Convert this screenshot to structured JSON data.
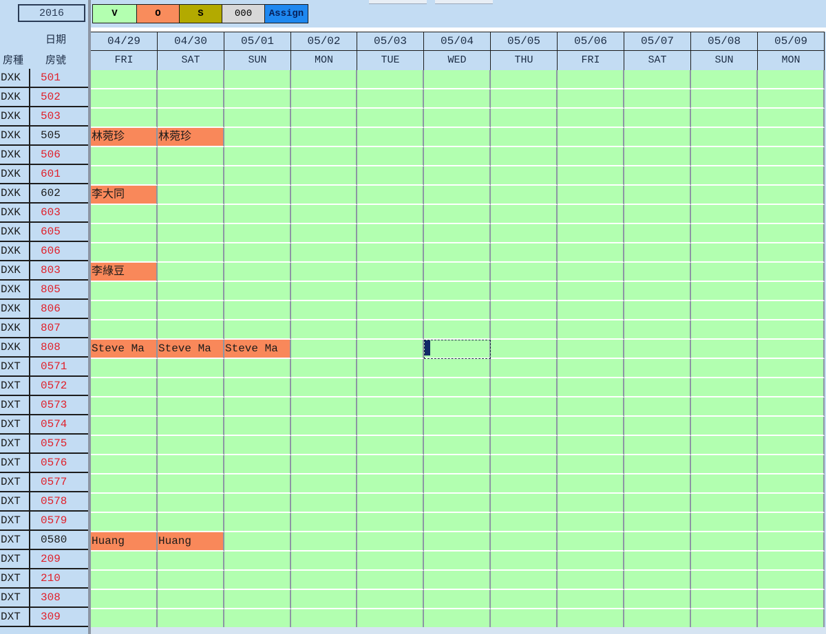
{
  "year": "2016",
  "header": {
    "date_label": "日期",
    "type_label": "房種",
    "room_label": "房號"
  },
  "legend": [
    {
      "key": "v",
      "label": "V",
      "color": "#b3ffb0"
    },
    {
      "key": "o",
      "label": "O",
      "color": "#f98c5c"
    },
    {
      "key": "s",
      "label": "S",
      "color": "#b3aa00"
    },
    {
      "key": "000",
      "label": "000",
      "color": "#d8d8d8"
    },
    {
      "key": "assign",
      "label": "Assign",
      "color": "#1e88f0"
    }
  ],
  "days": [
    {
      "date": "04/29",
      "dow": "FRI"
    },
    {
      "date": "04/30",
      "dow": "SAT"
    },
    {
      "date": "05/01",
      "dow": "SUN"
    },
    {
      "date": "05/02",
      "dow": "MON"
    },
    {
      "date": "05/03",
      "dow": "TUE"
    },
    {
      "date": "05/04",
      "dow": "WED"
    },
    {
      "date": "05/05",
      "dow": "THU"
    },
    {
      "date": "05/06",
      "dow": "FRI"
    },
    {
      "date": "05/07",
      "dow": "SAT"
    },
    {
      "date": "05/08",
      "dow": "SUN"
    },
    {
      "date": "05/09",
      "dow": "MON"
    }
  ],
  "rooms": [
    {
      "type": "DXK",
      "room": "501",
      "status": "red",
      "bookings": []
    },
    {
      "type": "DXK",
      "room": "502",
      "status": "red",
      "bookings": []
    },
    {
      "type": "DXK",
      "room": "503",
      "status": "red",
      "bookings": []
    },
    {
      "type": "DXK",
      "room": "505",
      "status": "black",
      "bookings": [
        {
          "day": 0,
          "name": "林菀珍"
        },
        {
          "day": 1,
          "name": "林菀珍"
        }
      ]
    },
    {
      "type": "DXK",
      "room": "506",
      "status": "red",
      "bookings": []
    },
    {
      "type": "DXK",
      "room": "601",
      "status": "red",
      "bookings": []
    },
    {
      "type": "DXK",
      "room": "602",
      "status": "black",
      "bookings": [
        {
          "day": 0,
          "name": "李大同"
        }
      ]
    },
    {
      "type": "DXK",
      "room": "603",
      "status": "red",
      "bookings": []
    },
    {
      "type": "DXK",
      "room": "605",
      "status": "red",
      "bookings": []
    },
    {
      "type": "DXK",
      "room": "606",
      "status": "red",
      "bookings": []
    },
    {
      "type": "DXK",
      "room": "803",
      "status": "red",
      "bookings": [
        {
          "day": 0,
          "name": "李綠豆"
        }
      ]
    },
    {
      "type": "DXK",
      "room": "805",
      "status": "red",
      "bookings": []
    },
    {
      "type": "DXK",
      "room": "806",
      "status": "red",
      "bookings": []
    },
    {
      "type": "DXK",
      "room": "807",
      "status": "red",
      "bookings": []
    },
    {
      "type": "DXK",
      "room": "808",
      "status": "red",
      "bookings": [
        {
          "day": 0,
          "name": "Steve Ma"
        },
        {
          "day": 1,
          "name": "Steve Ma"
        },
        {
          "day": 2,
          "name": "Steve Ma"
        }
      ]
    },
    {
      "type": "DXT",
      "room": "0571",
      "status": "red",
      "bookings": []
    },
    {
      "type": "DXT",
      "room": "0572",
      "status": "red",
      "bookings": []
    },
    {
      "type": "DXT",
      "room": "0573",
      "status": "red",
      "bookings": []
    },
    {
      "type": "DXT",
      "room": "0574",
      "status": "red",
      "bookings": []
    },
    {
      "type": "DXT",
      "room": "0575",
      "status": "red",
      "bookings": []
    },
    {
      "type": "DXT",
      "room": "0576",
      "status": "red",
      "bookings": []
    },
    {
      "type": "DXT",
      "room": "0577",
      "status": "red",
      "bookings": []
    },
    {
      "type": "DXT",
      "room": "0578",
      "status": "red",
      "bookings": []
    },
    {
      "type": "DXT",
      "room": "0579",
      "status": "red",
      "bookings": []
    },
    {
      "type": "DXT",
      "room": "0580",
      "status": "black",
      "bookings": [
        {
          "day": 0,
          "name": "Huang"
        },
        {
          "day": 1,
          "name": "Huang"
        }
      ]
    },
    {
      "type": "DXT",
      "room": "209",
      "status": "red",
      "bookings": []
    },
    {
      "type": "DXT",
      "room": "210",
      "status": "red",
      "bookings": []
    },
    {
      "type": "DXT",
      "room": "308",
      "status": "red",
      "bookings": []
    },
    {
      "type": "DXT",
      "room": "309",
      "status": "red",
      "bookings": []
    }
  ],
  "selection": {
    "room_index": 14,
    "day": 5
  }
}
